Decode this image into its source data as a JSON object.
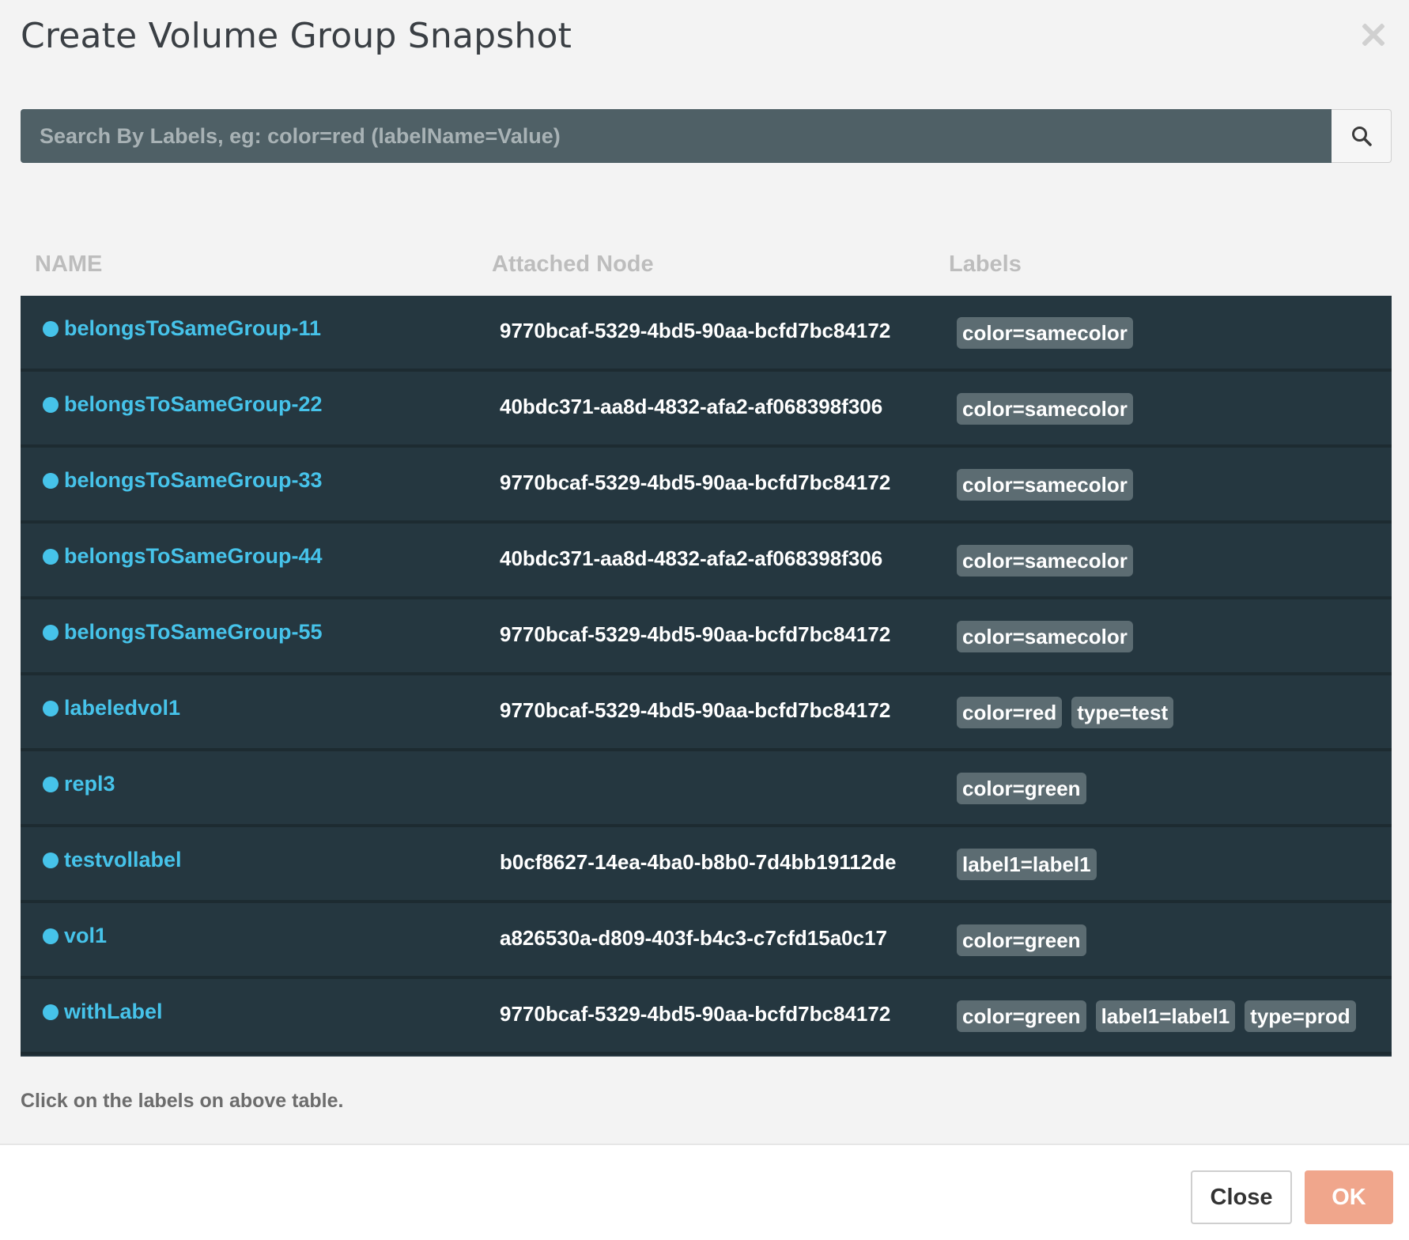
{
  "dialog": {
    "title": "Create Volume Group Snapshot"
  },
  "search": {
    "placeholder": "Search By Labels, eg: color=red (labelName=Value)"
  },
  "table": {
    "columns": [
      "NAME",
      "Attached Node",
      "Labels"
    ],
    "rows": [
      {
        "name": "belongsToSameGroup-11",
        "node": "9770bcaf-5329-4bd5-90aa-bcfd7bc84172",
        "labels": [
          "color=samecolor"
        ]
      },
      {
        "name": "belongsToSameGroup-22",
        "node": "40bdc371-aa8d-4832-afa2-af068398f306",
        "labels": [
          "color=samecolor"
        ]
      },
      {
        "name": "belongsToSameGroup-33",
        "node": "9770bcaf-5329-4bd5-90aa-bcfd7bc84172",
        "labels": [
          "color=samecolor"
        ]
      },
      {
        "name": "belongsToSameGroup-44",
        "node": "40bdc371-aa8d-4832-afa2-af068398f306",
        "labels": [
          "color=samecolor"
        ]
      },
      {
        "name": "belongsToSameGroup-55",
        "node": "9770bcaf-5329-4bd5-90aa-bcfd7bc84172",
        "labels": [
          "color=samecolor"
        ]
      },
      {
        "name": "labeledvol1",
        "node": "9770bcaf-5329-4bd5-90aa-bcfd7bc84172",
        "labels": [
          "color=red",
          "type=test"
        ]
      },
      {
        "name": "repl3",
        "node": "",
        "labels": [
          "color=green"
        ]
      },
      {
        "name": "testvollabel",
        "node": "b0cf8627-14ea-4ba0-b8b0-7d4bb19112de",
        "labels": [
          "label1=label1"
        ]
      },
      {
        "name": "vol1",
        "node": "a826530a-d809-403f-b4c3-c7cfd15a0c17",
        "labels": [
          "color=green"
        ]
      },
      {
        "name": "withLabel",
        "node": "9770bcaf-5329-4bd5-90aa-bcfd7bc84172",
        "labels": [
          "color=green",
          "label1=label1",
          "type=prod"
        ]
      }
    ]
  },
  "hint": "Click on the labels on above table.",
  "footer": {
    "close_label": "Close",
    "ok_label": "OK"
  },
  "icons": {
    "search": "search-icon",
    "close": "close-icon",
    "status": "status-dot-icon"
  },
  "colors": {
    "table_bg": "#253740",
    "link": "#46c3ea",
    "chip": "#5c6c72",
    "ok_button": "#f0a68c",
    "search_bg": "#4f6066"
  }
}
